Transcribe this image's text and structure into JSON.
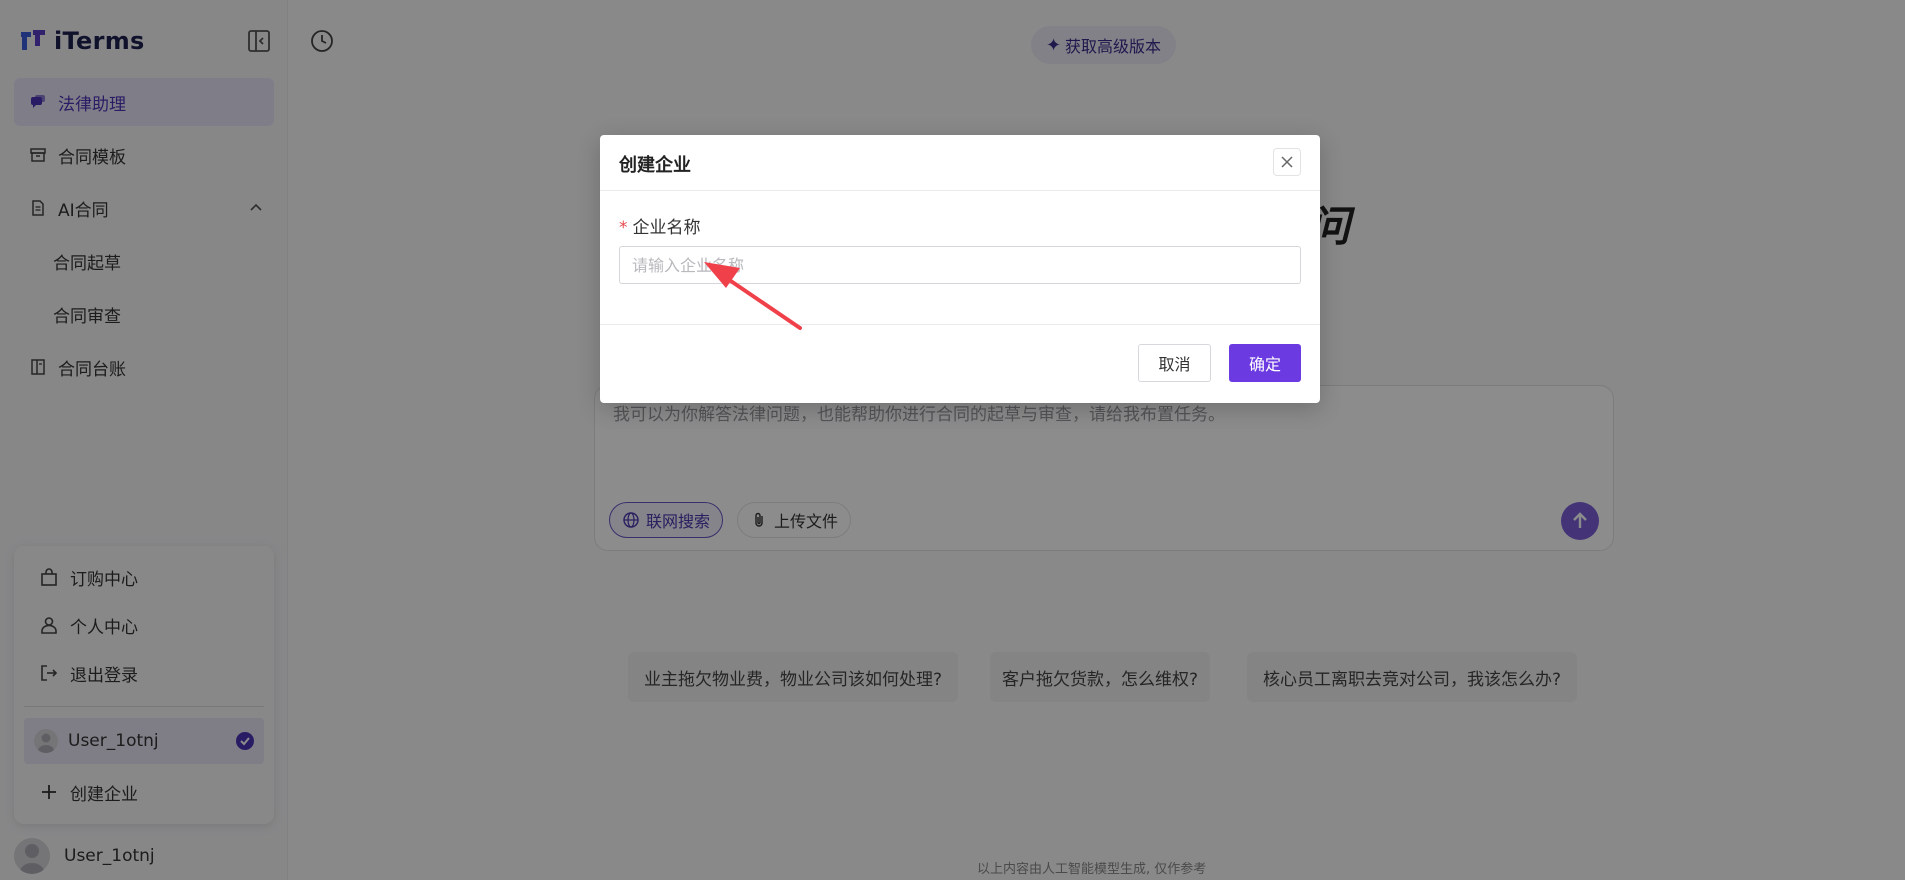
{
  "app": {
    "logo_text": "iTerms"
  },
  "sidebar": {
    "items": [
      {
        "label": "法律助理",
        "icon": "chat-bubbles-icon",
        "active": true
      },
      {
        "label": "合同模板",
        "icon": "archive-box-icon"
      },
      {
        "label": "AI合同",
        "icon": "document-icon",
        "expanded": true
      },
      {
        "label": "合同起草",
        "sub": true
      },
      {
        "label": "合同审查",
        "sub": true
      },
      {
        "label": "合同台账",
        "icon": "ledger-book-icon"
      }
    ]
  },
  "account_menu": {
    "items": [
      {
        "label": "订购中心",
        "icon": "shopping-bag-icon"
      },
      {
        "label": "个人中心",
        "icon": "user-icon"
      },
      {
        "label": "退出登录",
        "icon": "logout-icon"
      }
    ],
    "current_account": "User_1otnj",
    "create_label": "创建企业"
  },
  "footer_user": {
    "name": "User_1otnj"
  },
  "main": {
    "upgrade_label": "获取高级版本",
    "hero_partial": "问",
    "chat_placeholder": "我可以为你解答法律问题，也能帮助你进行合同的起草与审查，请给我布置任务。",
    "web_search_label": "联网搜索",
    "upload_label": "上传文件",
    "suggestions": [
      "业主拖欠物业费，物业公司该如何处理?",
      "客户拖欠货款，怎么维权?",
      "核心员工离职去竞对公司，我该怎么办?"
    ],
    "disclaimer": "以上内容由人工智能模型生成, 仅作参考"
  },
  "modal": {
    "title": "创建企业",
    "field_label": "企业名称",
    "required_mark": "*",
    "field_value": "",
    "field_placeholder": "请输入企业名称",
    "cancel_label": "取消",
    "confirm_label": "确定"
  },
  "colors": {
    "accent": "#6b3ae0",
    "active_nav_bg": "#e8e5f7",
    "annotation_arrow": "#f0404a"
  }
}
